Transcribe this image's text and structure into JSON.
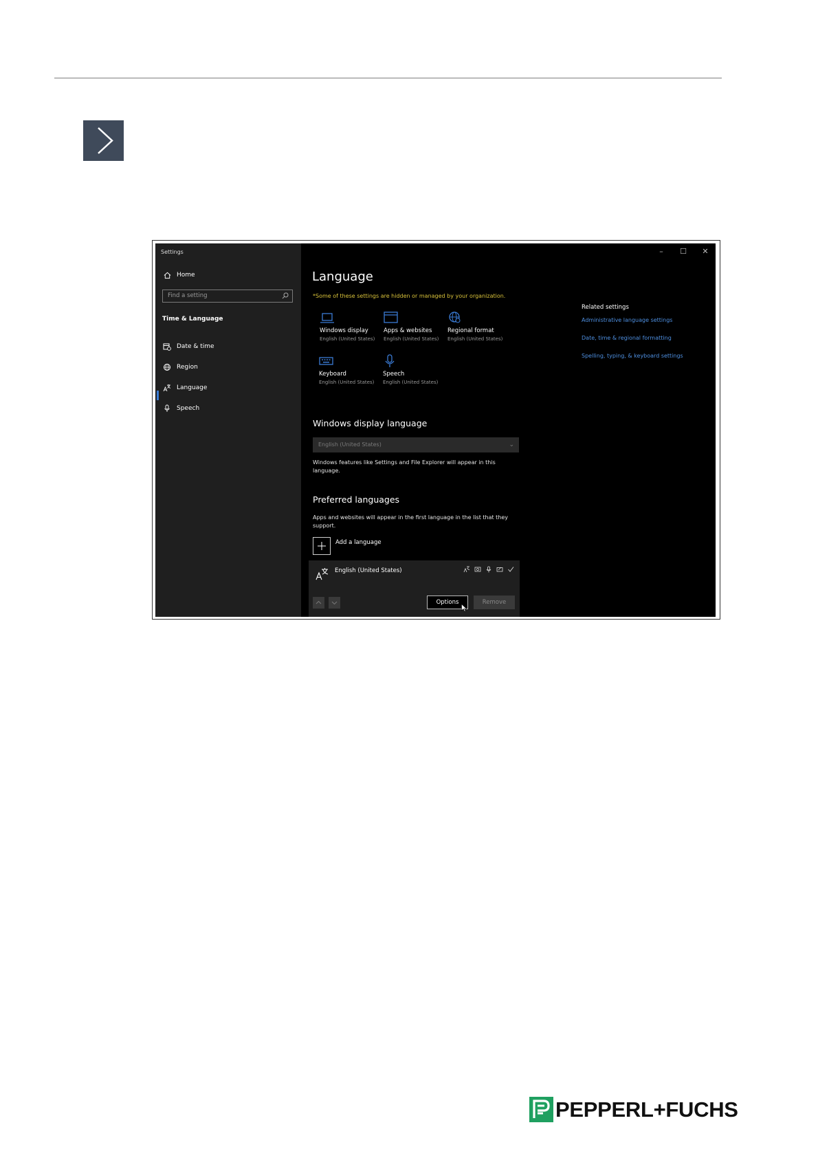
{
  "window": {
    "title": "Settings",
    "controls": {
      "minimize": "–",
      "maximize": "☐",
      "close": "✕"
    }
  },
  "sidebar": {
    "home_label": "Home",
    "search_placeholder": "Find a setting",
    "section_heading": "Time & Language",
    "items": [
      {
        "label": "Date & time",
        "icon": "calendar-clock-icon"
      },
      {
        "label": "Region",
        "icon": "globe-icon"
      },
      {
        "label": "Language",
        "icon": "language-icon",
        "active": true
      },
      {
        "label": "Speech",
        "icon": "microphone-icon"
      }
    ]
  },
  "main": {
    "title": "Language",
    "managed_note": "*Some of these settings are hidden or managed by your organization.",
    "tiles": [
      {
        "name": "Windows display",
        "sub": "English (United States)",
        "icon": "laptop-icon"
      },
      {
        "name": "Apps & websites",
        "sub": "English (United States)",
        "icon": "window-icon"
      },
      {
        "name": "Regional format",
        "sub": "English (United States)",
        "icon": "globe-format-icon"
      },
      {
        "name": "Keyboard",
        "sub": "English (United States)",
        "icon": "keyboard-icon"
      },
      {
        "name": "Speech",
        "sub": "English (United States)",
        "icon": "microphone-icon"
      }
    ],
    "display_language": {
      "title": "Windows display language",
      "selected": "English (United States)",
      "description": "Windows features like Settings and File Explorer will appear in this language."
    },
    "preferred": {
      "title": "Preferred languages",
      "description": "Apps and websites will appear in the first language in the list that they support.",
      "add_label": "Add a language",
      "languages": [
        {
          "name": "English (United States)",
          "options_label": "Options",
          "remove_label": "Remove"
        }
      ]
    }
  },
  "related": {
    "heading": "Related settings",
    "links": [
      "Administrative language settings",
      "Date, time & regional formatting",
      "Spelling, typing, & keyboard settings"
    ]
  },
  "brand": {
    "name": "PEPPERL+FUCHS",
    "color": "#1fa060"
  },
  "colors": {
    "accent": "#4e8fe0",
    "warning": "#d9c23a",
    "step_box": "#3f4a5a"
  }
}
